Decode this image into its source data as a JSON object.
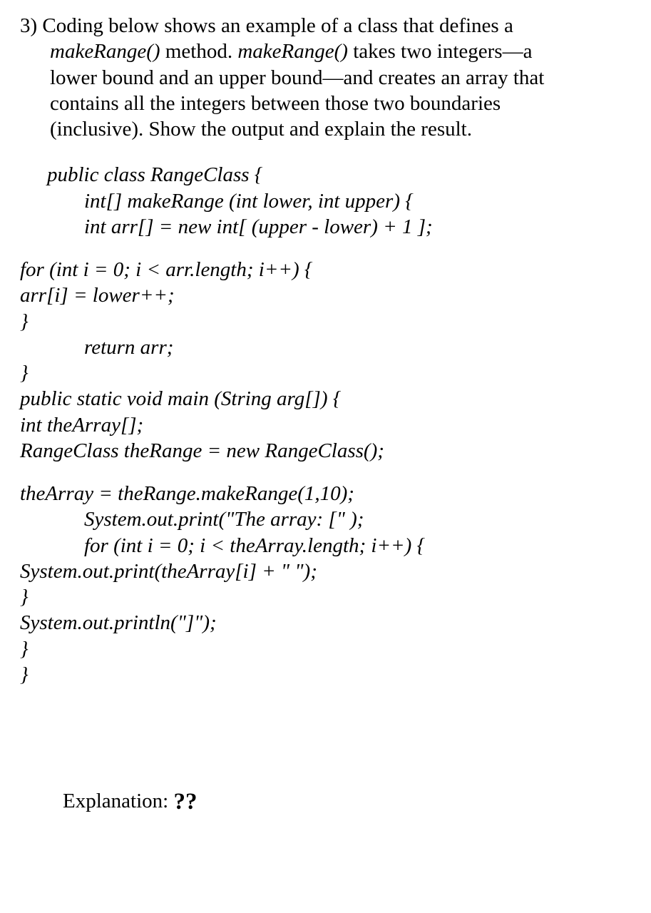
{
  "question": {
    "number": "3)",
    "text_l1": "Coding below shows an example of a class that defines a",
    "text_l2_pre": "makeRange()",
    "text_l2_mid": " method. ",
    "text_l2_post": "makeRange()",
    "text_l2_tail": " takes two integers—a",
    "text_l3": "lower bound and an upper bound—and creates an array that",
    "text_l4": "contains all the integers between those two boundaries",
    "text_l5": "(inclusive). Show the output and explain the result."
  },
  "code": {
    "l01": "public class RangeClass {",
    "l02": "int[] makeRange (int lower, int upper) {",
    "l03": "int arr[] = new int[ (upper - lower) + 1 ];",
    "l04": "for (int i = 0; i < arr.length; i++) {",
    "l05": "arr[i] = lower++;",
    "l06": "}",
    "l07": "return arr;",
    "l08": "}",
    "l09": "public static void main (String arg[]) {",
    "l10": "int theArray[];",
    "l11": "RangeClass theRange = new RangeClass();",
    "l12": "theArray = theRange.makeRange(1,10);",
    "l13": "System.out.print(\"The array: [\" );",
    "l14": "for (int i = 0; i < theArray.length; i++) {",
    "l15": "System.out.print(theArray[i] + \" \");",
    "l16": "}",
    "l17": "System.out.println(\"]\");",
    "l18": "}",
    "l19": "}"
  },
  "explanation": {
    "label": "Explanation:",
    "value": "??"
  }
}
